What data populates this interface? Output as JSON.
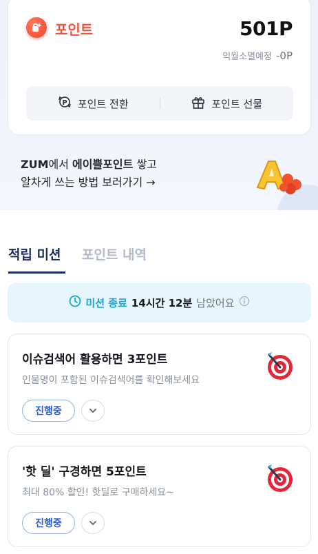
{
  "point": {
    "title": "포인트",
    "value": "501P",
    "expire_label": "익월소멸예정",
    "expire_value": "-0P",
    "actions": [
      {
        "label": "포인트 전환",
        "icon": "point-exchange-icon"
      },
      {
        "label": "포인트 선물",
        "icon": "gift-icon"
      }
    ]
  },
  "promo": {
    "line1_brand": "ZUM",
    "line1_mid": "에서 ",
    "line1_bold": "에이쁠포인트",
    "line1_end": " 쌓고",
    "line2": "알차게 쓰는 방법 보러가기",
    "arrow": "→"
  },
  "tabs": [
    {
      "label": "적립 미션",
      "active": true
    },
    {
      "label": "포인트 내역",
      "active": false
    }
  ],
  "timer": {
    "label": "미션 종료",
    "value": "14시간 12분",
    "suffix": "남았어요",
    "info_icon": "info-icon"
  },
  "missions": [
    {
      "title": "이슈검색어 활용하면 3포인트",
      "desc": "인물명이 포함된 이슈검색어를 확인해보세요",
      "status": "진행중"
    },
    {
      "title": "'핫 딜' 구경하면 5포인트",
      "desc": "최대 80% 할인! 핫딜로 구매하세요~",
      "status": "진행중"
    }
  ],
  "colors": {
    "accent_orange": "#f0513c",
    "accent_navy": "#1a2b5e",
    "accent_cyan": "#1ba6d6",
    "status_blue": "#2d5fc9"
  }
}
